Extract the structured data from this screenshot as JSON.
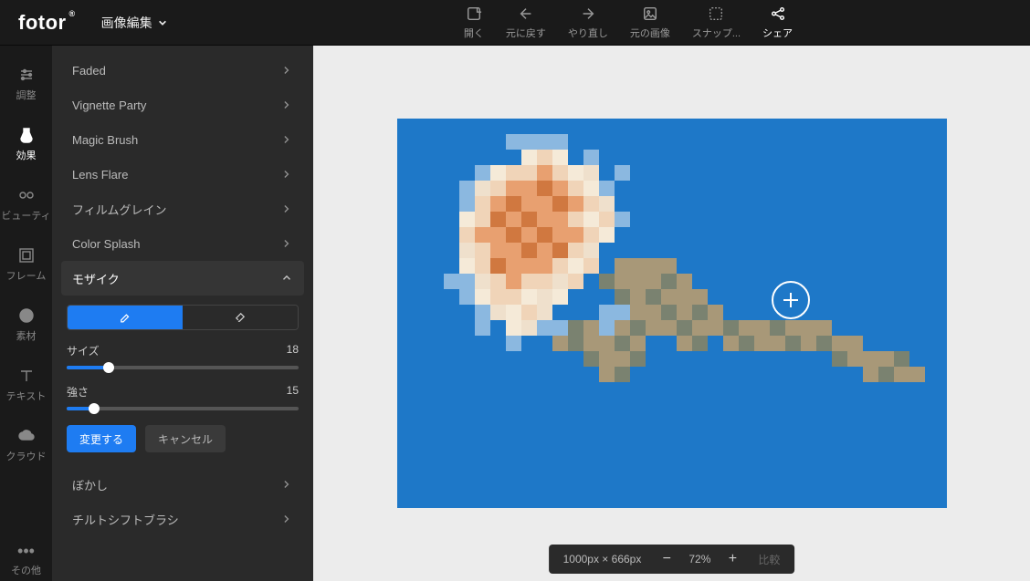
{
  "logo": "fotor",
  "mode_label": "画像編集",
  "top_actions": [
    {
      "id": "open",
      "label": "開く"
    },
    {
      "id": "undo",
      "label": "元に戻す"
    },
    {
      "id": "redo",
      "label": "やり直し"
    },
    {
      "id": "original",
      "label": "元の画像"
    },
    {
      "id": "snap",
      "label": "スナップ..."
    },
    {
      "id": "share",
      "label": "シェア"
    }
  ],
  "rail": [
    {
      "id": "adjust",
      "label": "調整"
    },
    {
      "id": "effects",
      "label": "効果",
      "active": true
    },
    {
      "id": "beauty",
      "label": "ビューティ"
    },
    {
      "id": "frame",
      "label": "フレーム"
    },
    {
      "id": "sticker",
      "label": "素材"
    },
    {
      "id": "text",
      "label": "テキスト"
    },
    {
      "id": "cloud",
      "label": "クラウド"
    }
  ],
  "rail_other": "その他",
  "effects": [
    {
      "name": "Faded"
    },
    {
      "name": "Vignette Party"
    },
    {
      "name": "Magic Brush"
    },
    {
      "name": "Lens Flare"
    },
    {
      "name": "フィルムグレイン"
    },
    {
      "name": "Color Splash"
    },
    {
      "name": "モザイク",
      "active": true
    },
    {
      "name": "ぼかし"
    },
    {
      "name": "チルトシフトブラシ"
    }
  ],
  "mosaic": {
    "size_label": "サイズ",
    "size_value": "18",
    "size_pct": 18,
    "intensity_label": "強さ",
    "intensity_value": "15",
    "intensity_pct": 12,
    "apply": "変更する",
    "cancel": "キャンセル"
  },
  "status": {
    "dims": "1000px × 666px",
    "zoom": "72%",
    "compare": "比較"
  }
}
